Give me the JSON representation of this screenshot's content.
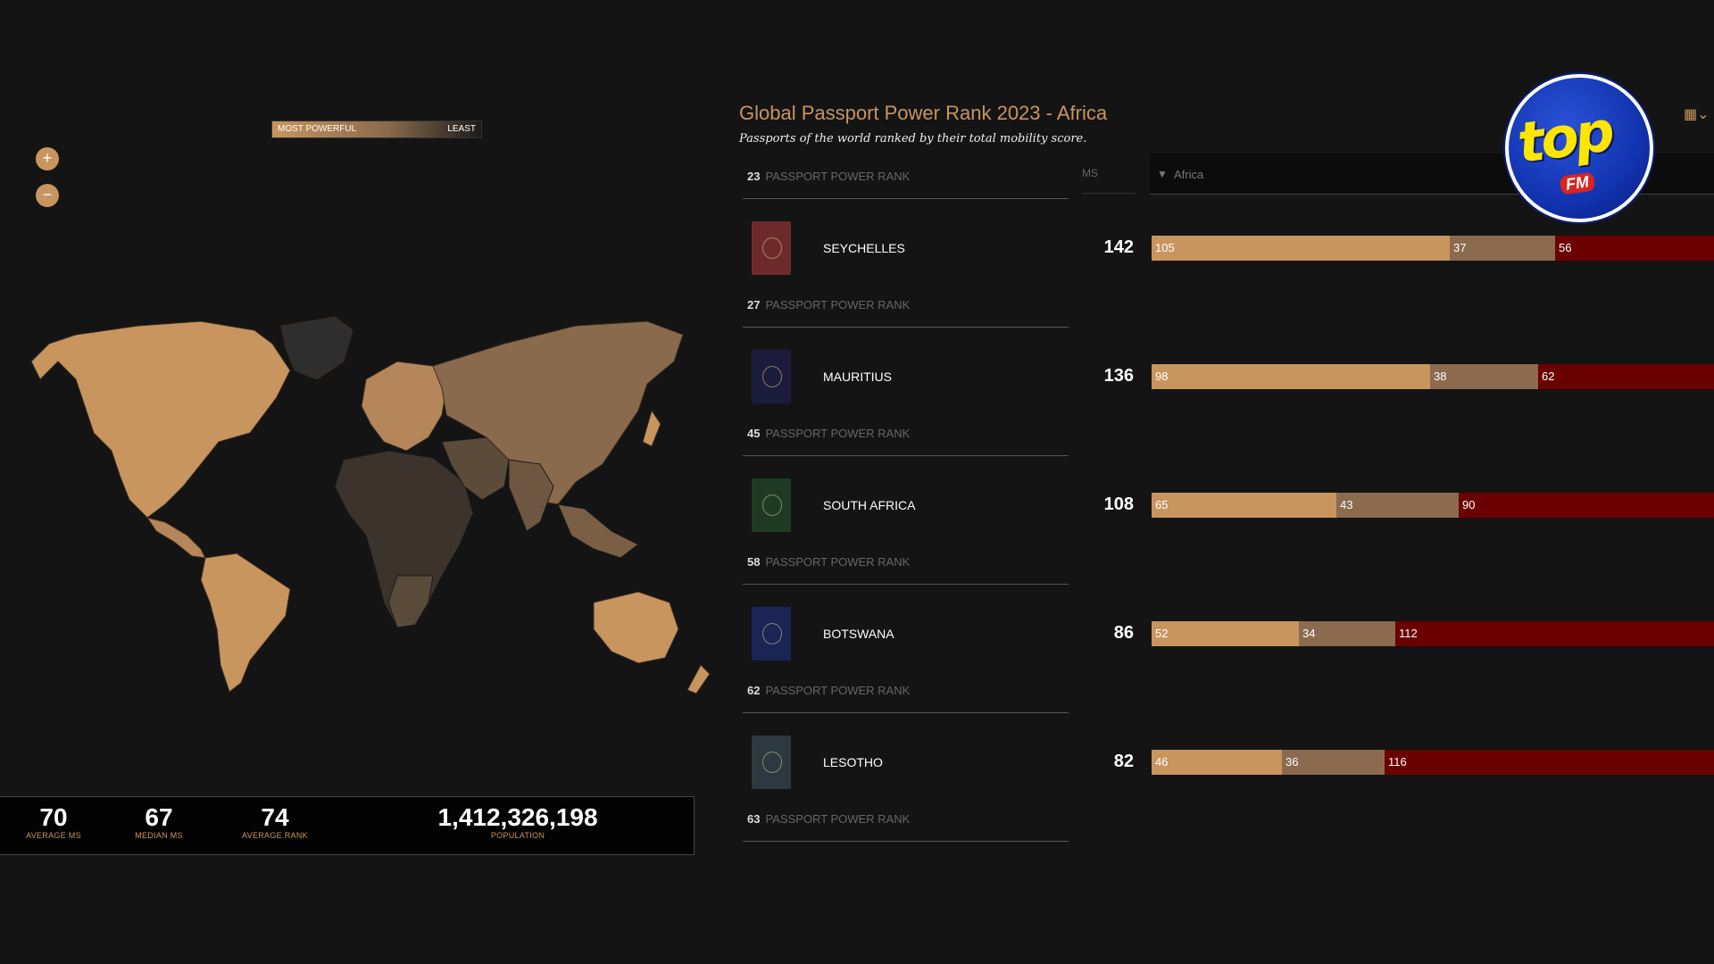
{
  "map": {
    "legend": {
      "most": "MOST POWERFUL",
      "least": "LEAST"
    },
    "zoom_in": "+",
    "zoom_out": "−"
  },
  "stats": [
    {
      "value": "70",
      "label": "AVERAGE MS"
    },
    {
      "value": "67",
      "label": "MEDIAN MS"
    },
    {
      "value": "74",
      "label": "AVERAGE RANK"
    },
    {
      "value": "1,412,326,198",
      "label": "POPULATION"
    }
  ],
  "header": {
    "title": "Global Passport Power Rank 2023 - Africa",
    "subtitle": "Passports of the world ranked by their total mobility score.",
    "ms_label": "MS",
    "filter_value": "Africa"
  },
  "rank_label": "PASSPORT POWER RANK",
  "rows": [
    {
      "rank_above": "23",
      "country": "SEYCHELLES",
      "score": "142",
      "segs": [
        105,
        37,
        56
      ],
      "passport_color": "#6e2a2a"
    },
    {
      "rank_above": "27",
      "country": "MAURITIUS",
      "score": "136",
      "segs": [
        98,
        38,
        62
      ],
      "passport_color": "#1b1b3c"
    },
    {
      "rank_above": "45",
      "country": "SOUTH AFRICA",
      "score": "108",
      "segs": [
        65,
        43,
        90
      ],
      "passport_color": "#1f3a22"
    },
    {
      "rank_above": "58",
      "country": "BOTSWANA",
      "score": "86",
      "segs": [
        52,
        34,
        112
      ],
      "passport_color": "#1a2556"
    },
    {
      "rank_above": "62",
      "country": "LESOTHO",
      "score": "82",
      "segs": [
        46,
        36,
        116
      ],
      "passport_color": "#2c3940"
    }
  ],
  "final_rank": "63",
  "logo": {
    "word": "top",
    "badge": "FM"
  },
  "colors": {
    "accent": "#c8955f",
    "visa_on_arrival": "#8b6a4f",
    "visa_required": "#6b0000"
  }
}
